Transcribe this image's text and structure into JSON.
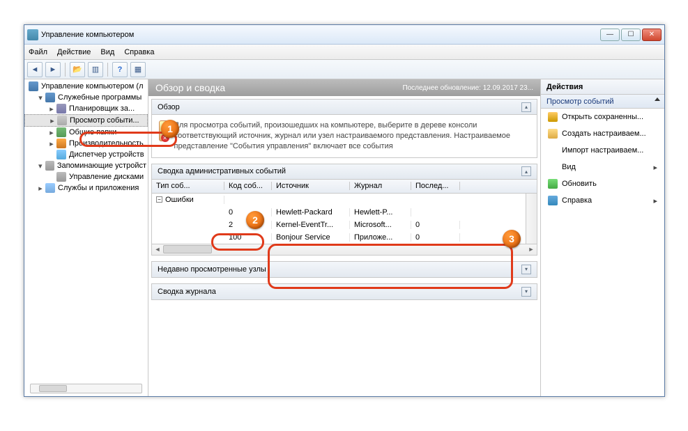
{
  "window": {
    "title": "Управление компьютером"
  },
  "menubar": {
    "file": "Файл",
    "action": "Действие",
    "view": "Вид",
    "help": "Справка"
  },
  "tree": {
    "root": "Управление компьютером (л",
    "items": [
      {
        "label": "Служебные программы",
        "icon": "ti-root",
        "indent": 1,
        "caret": "▾"
      },
      {
        "label": "Планировщик за...",
        "icon": "ti-task",
        "indent": 2,
        "caret": "▸"
      },
      {
        "label": "Просмотр событи...",
        "icon": "ti-event",
        "indent": 2,
        "caret": "▸",
        "sel": true
      },
      {
        "label": "Общие папки",
        "icon": "ti-share",
        "indent": 2,
        "caret": "▸"
      },
      {
        "label": "Производительность",
        "icon": "ti-perf",
        "indent": 2,
        "caret": "▸"
      },
      {
        "label": "Диспетчер устройств",
        "icon": "ti-dev",
        "indent": 2,
        "caret": ""
      },
      {
        "label": "Запоминающие устройст",
        "icon": "ti-disk",
        "indent": 1,
        "caret": "▾"
      },
      {
        "label": "Управление дисками",
        "icon": "ti-disk",
        "indent": 2,
        "caret": ""
      },
      {
        "label": "Службы и приложения",
        "icon": "ti-svc",
        "indent": 1,
        "caret": "▸"
      }
    ]
  },
  "center": {
    "header": {
      "title": "Обзор и сводка",
      "updated": "Последнее обновление: 12.09.2017 23..."
    },
    "overview": {
      "title": "Обзор",
      "text": "Для просмотра событий, произошедших на компьютере, выберите в дереве консоли соответствующий источник, журнал или узел настраиваемого представления. Настраиваемое представление \"События управления\" включает все события"
    },
    "admin_summary": {
      "title": "Сводка административных событий",
      "columns": [
        "Тип соб...",
        "Код соб...",
        "Источник",
        "Журнал",
        "Послед..."
      ],
      "group": "Ошибки",
      "rows": [
        {
          "code": "0",
          "source": "Hewlett-Packard",
          "journal": "Hewlett-P...",
          "last": ""
        },
        {
          "code": "2",
          "source": "Kernel-EventTr...",
          "journal": "Microsoft...",
          "last": "0"
        },
        {
          "code": "100",
          "source": "Bonjour Service",
          "journal": "Приложе...",
          "last": "0"
        }
      ]
    },
    "recent": {
      "title": "Недавно просмотренные узлы"
    },
    "log_summary": {
      "title": "Сводка журнала"
    }
  },
  "actions": {
    "header": "Действия",
    "group": "Просмотр событий",
    "items": [
      {
        "label": "Открыть сохраненны...",
        "icon": "ai-open"
      },
      {
        "label": "Создать настраиваем...",
        "icon": "ai-filter"
      },
      {
        "label": "Импорт настраиваем..."
      },
      {
        "label": "Вид",
        "icon": "ai-view",
        "sub": true
      },
      {
        "label": "Обновить",
        "icon": "ai-refresh"
      },
      {
        "label": "Справка",
        "icon": "ai-help",
        "sub": true
      }
    ]
  },
  "callouts": {
    "c1": "1",
    "c2": "2",
    "c3": "3"
  }
}
